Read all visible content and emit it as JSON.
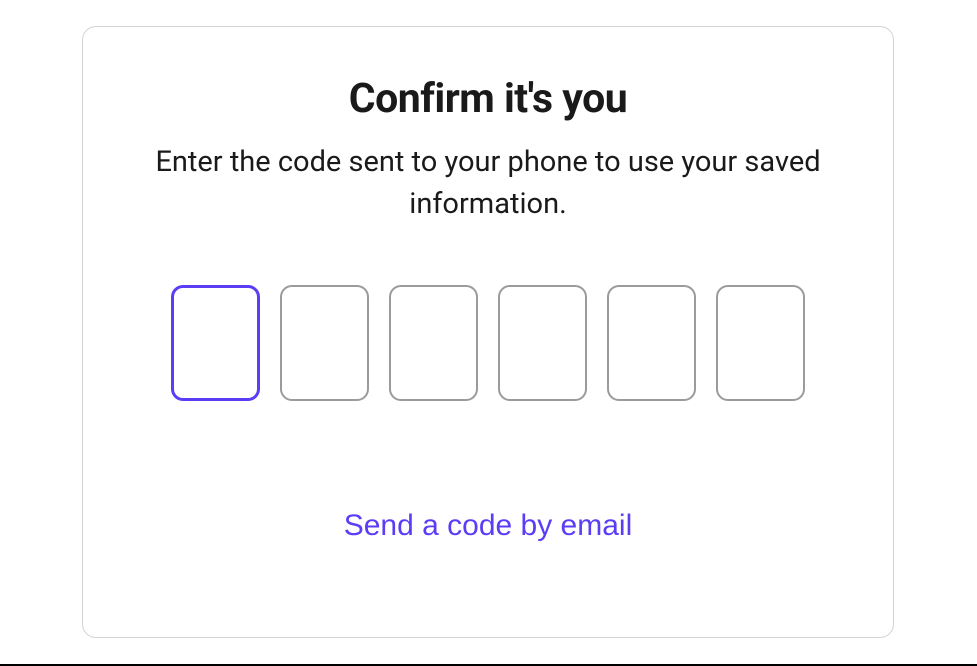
{
  "dialog": {
    "title": "Confirm it's you",
    "subtitle": "Enter the code sent to your phone to use your saved information.",
    "code": {
      "digits": [
        "",
        "",
        "",
        "",
        "",
        ""
      ],
      "focused_index": 0
    },
    "alt_action_label": "Send a code by email"
  },
  "colors": {
    "accent": "#5b3df5",
    "border_default": "#9b9b9b",
    "card_border": "#d4d4d4",
    "text": "#1a1a1a"
  }
}
